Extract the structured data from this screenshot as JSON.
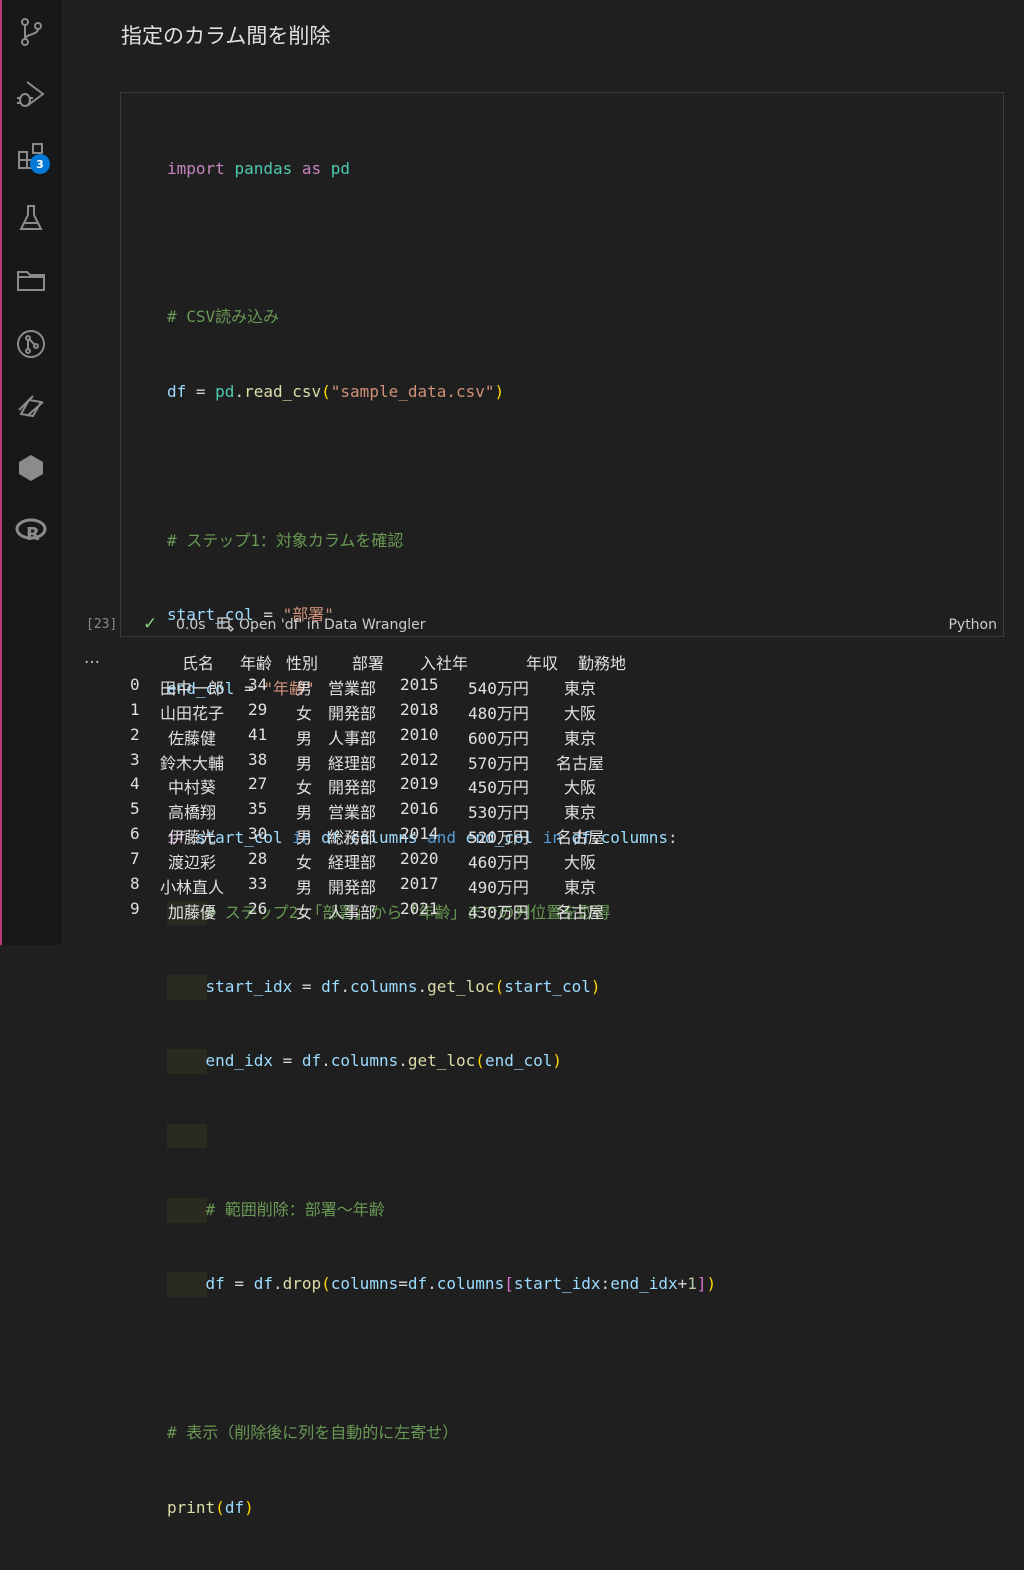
{
  "activity_bar": {
    "icons": [
      "source-control-icon",
      "run-debug-icon",
      "extensions-icon",
      "testing-icon",
      "explorer-icon",
      "git-graph-icon",
      "remote-icon",
      "hexagon-icon",
      "r-language-icon"
    ],
    "extensions_badge": "3"
  },
  "notebook": {
    "markdown_title": "指定のカラム間を削除",
    "execution_count": "[23]",
    "duration": "0.0s",
    "wrangler_label": "Open 'df' in Data Wrangler",
    "language": "Python",
    "output_ellipsis": "…"
  },
  "code_lines": [
    "import pandas as pd",
    "",
    "# CSV読み込み",
    "df = pd.read_csv(\"sample_data.csv\")",
    "",
    "# ステップ1：対象カラムを確認",
    "start_col = \"部署\"",
    "end_col = \"年齢\"",
    "",
    "if start_col in df.columns and end_col in df.columns:",
    "    # ステップ2：「部署」から「年齢」までの列位置を取得",
    "    start_idx = df.columns.get_loc(start_col)",
    "    end_idx = df.columns.get_loc(end_col)",
    "",
    "    # 範囲削除：部署〜年齢",
    "    df = df.drop(columns=df.columns[start_idx:end_idx+1])",
    "",
    "# 表示（削除後に列を自動的に左寄せ）",
    "print(df)"
  ],
  "output_table": {
    "headers": [
      "氏名",
      "年齢",
      "性別",
      "部署",
      "入社年",
      "年収",
      "勤務地"
    ],
    "rows": [
      [
        "0",
        "田中一郎",
        "34",
        "男",
        "営業部",
        "2015",
        "540万円",
        "東京"
      ],
      [
        "1",
        "山田花子",
        "29",
        "女",
        "開発部",
        "2018",
        "480万円",
        "大阪"
      ],
      [
        "2",
        "佐藤健",
        "41",
        "男",
        "人事部",
        "2010",
        "600万円",
        "東京"
      ],
      [
        "3",
        "鈴木大輔",
        "38",
        "男",
        "経理部",
        "2012",
        "570万円",
        "名古屋"
      ],
      [
        "4",
        "中村葵",
        "27",
        "女",
        "開発部",
        "2019",
        "450万円",
        "大阪"
      ],
      [
        "5",
        "高橋翔",
        "35",
        "男",
        "営業部",
        "2016",
        "530万円",
        "東京"
      ],
      [
        "6",
        "伊藤光",
        "30",
        "男",
        "総務部",
        "2014",
        "520万円",
        "名古屋"
      ],
      [
        "7",
        "渡辺彩",
        "28",
        "女",
        "経理部",
        "2020",
        "460万円",
        "大阪"
      ],
      [
        "8",
        "小林直人",
        "33",
        "男",
        "開発部",
        "2017",
        "490万円",
        "東京"
      ],
      [
        "9",
        "加藤優",
        "26",
        "女",
        "人事部",
        "2021",
        "430万円",
        "名古屋"
      ]
    ]
  }
}
